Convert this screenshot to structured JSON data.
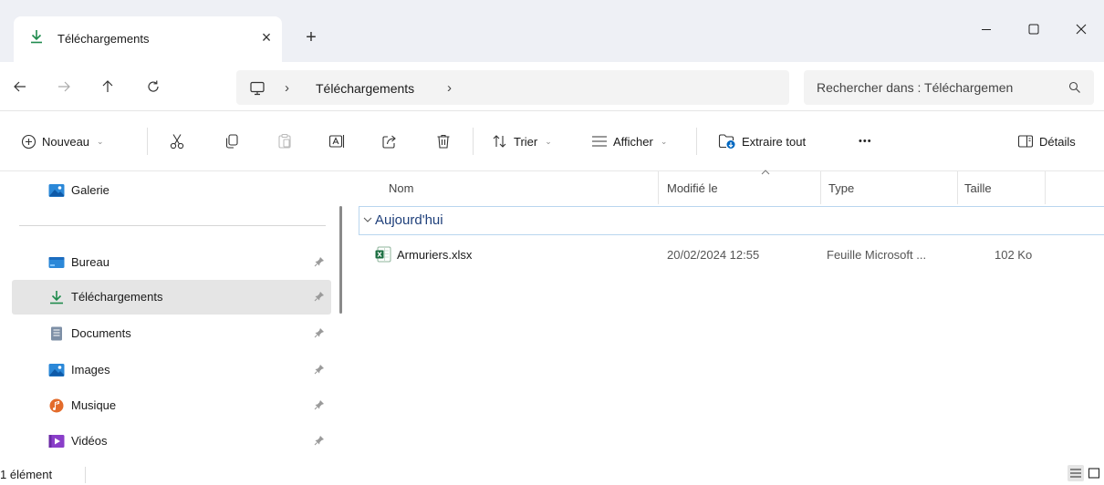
{
  "window": {
    "tab_title": "Téléchargements",
    "tab_close_glyph": "×",
    "new_tab_glyph": "+",
    "minimize_glyph": "—",
    "close_glyph": "✕"
  },
  "address": {
    "breadcrumb_separator": "›",
    "current_folder": "Téléchargements",
    "search_placeholder": "Rechercher dans : Téléchargemen"
  },
  "toolbar": {
    "new_label": "Nouveau",
    "sort_label": "Trier",
    "view_label": "Afficher",
    "extract_label": "Extraire tout",
    "more_glyph": "•••",
    "details_label": "Détails",
    "chevron_glyph": "⌄"
  },
  "sidebar": {
    "items": [
      {
        "label": "Galerie",
        "icon": "gallery-icon"
      },
      {
        "label": "Bureau",
        "icon": "desktop-icon",
        "pinned": true
      },
      {
        "label": "Téléchargements",
        "icon": "download-icon",
        "pinned": true,
        "selected": true
      },
      {
        "label": "Documents",
        "icon": "documents-icon",
        "pinned": true
      },
      {
        "label": "Images",
        "icon": "images-icon",
        "pinned": true
      },
      {
        "label": "Musique",
        "icon": "music-icon",
        "pinned": true
      },
      {
        "label": "Vidéos",
        "icon": "videos-icon",
        "pinned": true
      }
    ]
  },
  "columns": {
    "name": "Nom",
    "modified": "Modifié le",
    "type": "Type",
    "size": "Taille"
  },
  "group": {
    "label": "Aujourd'hui"
  },
  "files": [
    {
      "name": "Armuriers.xlsx",
      "modified": "20/02/2024 12:55",
      "type": "Feuille Microsoft ...",
      "size": "102 Ko",
      "icon": "excel-file-icon"
    }
  ],
  "status": {
    "count": "1 élément"
  },
  "colors": {
    "accent": "#0067c0",
    "download_green": "#1e8a4c",
    "excel_green": "#1d6f42",
    "selection_bg": "#e5e5e5",
    "group_text": "#1e3f7a"
  }
}
